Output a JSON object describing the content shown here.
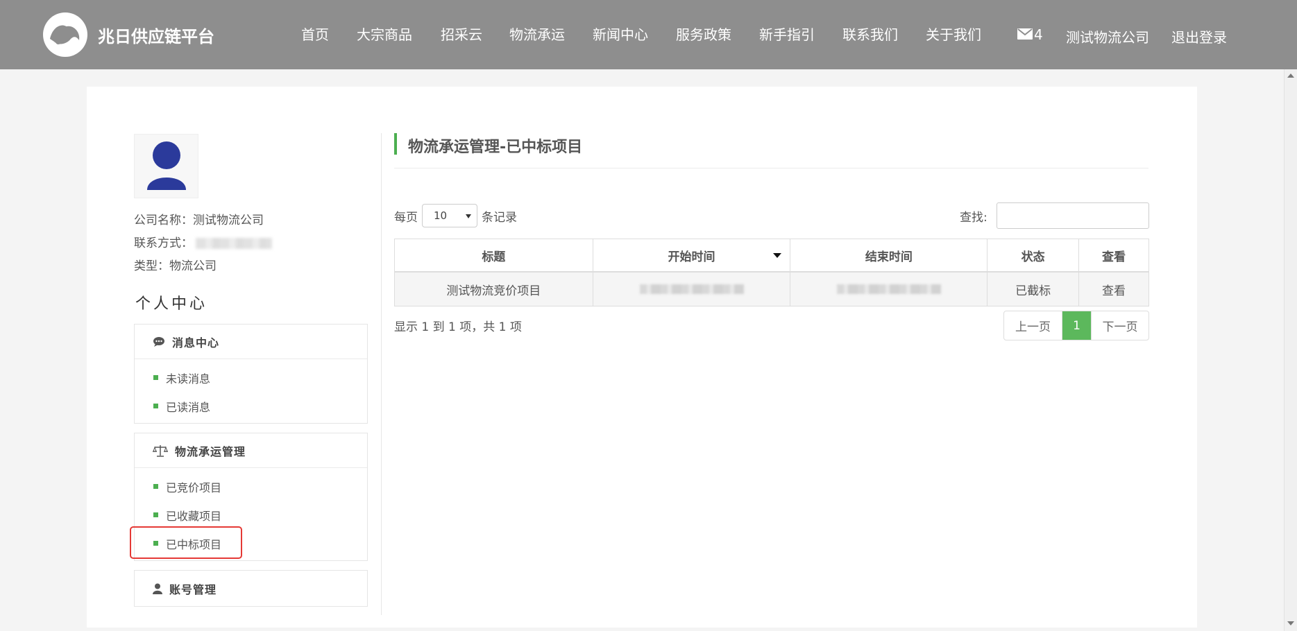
{
  "header": {
    "brand": "兆日供应链平台",
    "nav": [
      {
        "label": "首页"
      },
      {
        "label": "大宗商品"
      },
      {
        "label": "招采云"
      },
      {
        "label": "物流承运"
      },
      {
        "label": "新闻中心"
      },
      {
        "label": "服务政策"
      },
      {
        "label": "新手指引"
      },
      {
        "label": "联系我们"
      },
      {
        "label": "关于我们"
      }
    ],
    "mail_count": "4",
    "user_company": "测试物流公司",
    "logout": "退出登录"
  },
  "profile": {
    "company_line": "公司名称：测试物流公司",
    "contact_label": "联系方式：",
    "type_line": "类型：物流公司"
  },
  "sidebar": {
    "section_title": "个人中心",
    "panels": [
      {
        "title": "消息中心",
        "icon": "chat-icon",
        "items": [
          {
            "label": "未读消息"
          },
          {
            "label": "已读消息"
          }
        ]
      },
      {
        "title": "物流承运管理",
        "icon": "scale-icon",
        "items": [
          {
            "label": "已竞价项目"
          },
          {
            "label": "已收藏项目"
          },
          {
            "label": "已中标项目"
          }
        ]
      },
      {
        "title": "账号管理",
        "icon": "user-icon",
        "items": []
      }
    ]
  },
  "content": {
    "title": "物流承运管理-已中标项目",
    "per_page_prefix": "每页",
    "per_page_value": "10",
    "per_page_suffix": "条记录",
    "search_label": "查找:",
    "table": {
      "headers": [
        "标题",
        "开始时间",
        "结束时间",
        "状态",
        "查看"
      ],
      "rows": [
        {
          "title": "测试物流竞价项目",
          "status": "已截标",
          "action": "查看"
        }
      ]
    },
    "info": "显示 1 到 1 项，共 1 项",
    "pager": {
      "prev": "上一页",
      "current": "1",
      "next": "下一页"
    }
  },
  "colors": {
    "header_bg": "#8e8e8e",
    "accent": "#4caf50",
    "highlight": "#e53935"
  }
}
